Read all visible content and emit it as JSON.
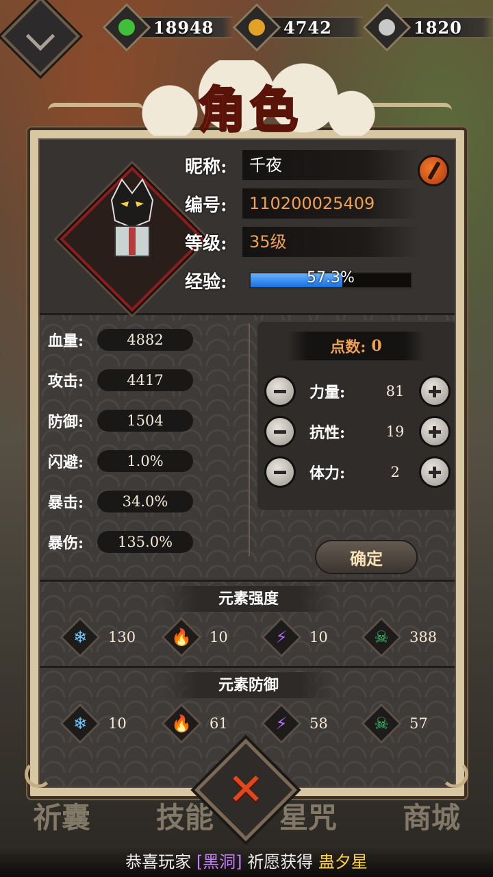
{
  "resources": [
    {
      "name": "jade",
      "value": "18948",
      "color": "#3fbf3a"
    },
    {
      "name": "gold",
      "value": "4742",
      "color": "#e3a126"
    },
    {
      "name": "silver",
      "value": "1820",
      "color": "#c9c9c9"
    }
  ],
  "title": "角色",
  "profile": {
    "nickname_label": "昵称:",
    "nickname": "千夜",
    "id_label": "编号:",
    "id": "110200025409",
    "level_label": "等级:",
    "level": "35级",
    "exp_label": "经验:",
    "exp_text": "57.3%",
    "exp_progress": 0.573
  },
  "stats": [
    {
      "label": "血量:",
      "value": "4882"
    },
    {
      "label": "攻击:",
      "value": "4417"
    },
    {
      "label": "防御:",
      "value": "1504"
    },
    {
      "label": "闪避:",
      "value": "1.0%"
    },
    {
      "label": "暴击:",
      "value": "34.0%"
    },
    {
      "label": "暴伤:",
      "value": "135.0%"
    }
  ],
  "points": {
    "title": "点数:",
    "value": "0",
    "rows": [
      {
        "label": "力量:",
        "value": "81"
      },
      {
        "label": "抗性:",
        "value": "19"
      },
      {
        "label": "体力:",
        "value": "2"
      }
    ],
    "confirm": "确定"
  },
  "element_strength": {
    "title": "元素强度",
    "items": [
      {
        "icon": "snowflake-icon",
        "glyph": "❄",
        "color": "#6ec8ff",
        "value": "130"
      },
      {
        "icon": "flame-icon",
        "glyph": "🔥",
        "color": "#f08a26",
        "value": "10"
      },
      {
        "icon": "lightning-icon",
        "glyph": "⚡",
        "color": "#b56cff",
        "value": "10"
      },
      {
        "icon": "skull-icon",
        "glyph": "☠",
        "color": "#39c46a",
        "value": "388"
      }
    ]
  },
  "element_defense": {
    "title": "元素防御",
    "items": [
      {
        "icon": "snowflake-icon",
        "glyph": "❄",
        "color": "#6ec8ff",
        "value": "10"
      },
      {
        "icon": "flame-icon",
        "glyph": "🔥",
        "color": "#f08a26",
        "value": "61"
      },
      {
        "icon": "lightning-icon",
        "glyph": "⚡",
        "color": "#b56cff",
        "value": "58"
      },
      {
        "icon": "skull-icon",
        "glyph": "☠",
        "color": "#39c46a",
        "value": "57"
      }
    ]
  },
  "bottom_nav": [
    "祈囊",
    "技能",
    "星咒",
    "商城"
  ],
  "ticker": {
    "prefix": "恭喜玩家",
    "name": "[黑洞]",
    "middle": "祈愿获得",
    "item": "蛊夕星"
  }
}
